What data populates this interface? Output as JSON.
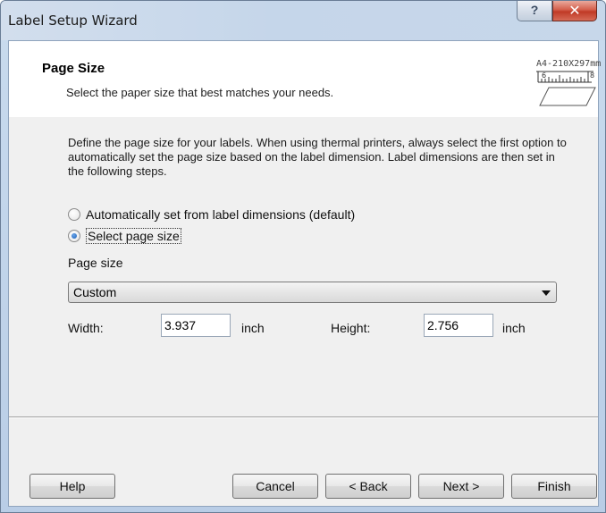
{
  "window": {
    "title": "Label Setup Wizard",
    "help_glyph": "?",
    "close_glyph": "✕"
  },
  "header": {
    "title": "Page Size",
    "subtitle": "Select the paper size that best matches your needs.",
    "graphic_label": "A4-210X297mm"
  },
  "body": {
    "description": "Define the page size for your labels. When using thermal printers, always select the first option to automatically set the page size based on the label dimension. Label dimensions are then set in the following steps.",
    "radio_auto": {
      "label": "Automatically set from label dimensions (default)",
      "checked": false
    },
    "radio_select": {
      "label": "Select page size",
      "checked": true
    },
    "page_size_label": "Page size",
    "page_size_value": "Custom",
    "width_label": "Width:",
    "width_value": "3.937",
    "width_unit": "inch",
    "height_label": "Height:",
    "height_value": "2.756",
    "height_unit": "inch"
  },
  "buttons": {
    "help": "Help",
    "cancel": "Cancel",
    "back": "< Back",
    "next": "Next >",
    "finish": "Finish"
  },
  "colors": {
    "title_bar": "#c5d6ea",
    "close_button": "#c8402c",
    "dialog_background": "#f0f0f0",
    "header_background": "#ffffff"
  }
}
